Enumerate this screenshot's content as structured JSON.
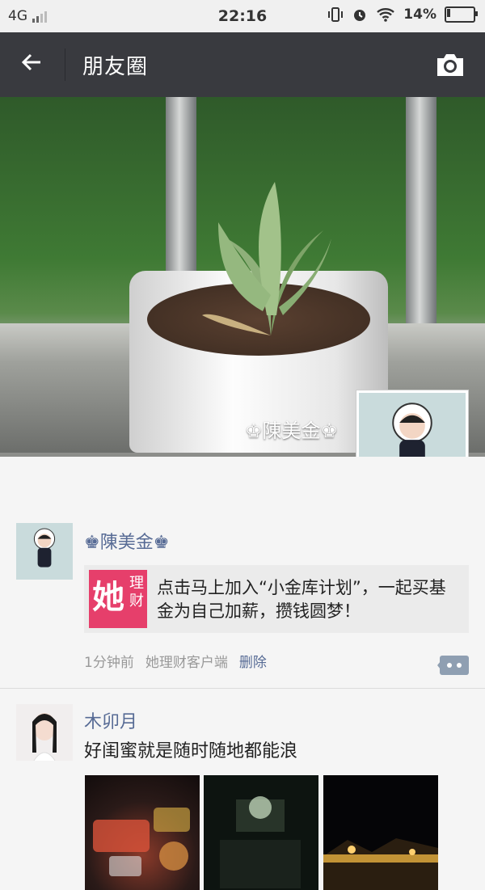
{
  "status_bar": {
    "network": "4G",
    "time": "22:16",
    "battery_percent": "14%",
    "battery_level": 0.14
  },
  "nav": {
    "title": "朋友圈",
    "back_icon": "arrow-left-icon",
    "camera_icon": "camera-icon"
  },
  "cover": {
    "user_name": "♚陳美金♚"
  },
  "posts": [
    {
      "author": "♚陳美金♚",
      "share": {
        "icon_big": "她",
        "icon_small": "理财",
        "text": "点击马上加入“小金库计划”，一起买基金为自己加薪，攒钱圆梦！"
      },
      "time": "1分钟前",
      "source": "她理财客户端",
      "delete_label": "删除"
    },
    {
      "author": "木卯月",
      "text": "好闺蜜就是随时随地都能浪"
    }
  ],
  "colors": {
    "nav_bg": "#393a3f",
    "link": "#576b95",
    "share_icon_bg": "#e63f6b"
  }
}
